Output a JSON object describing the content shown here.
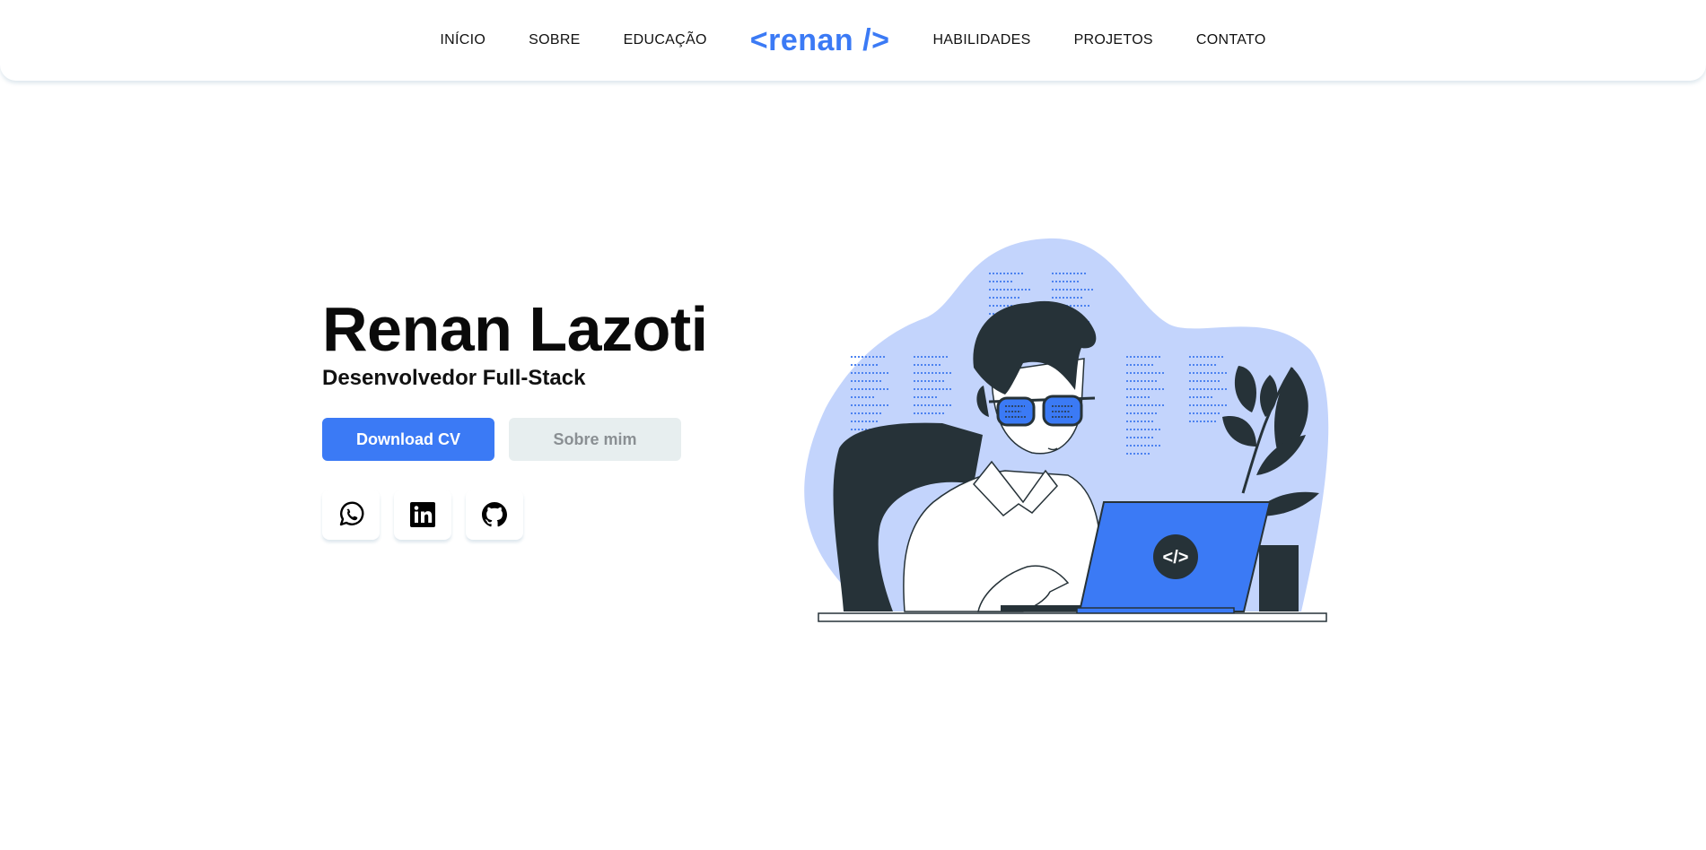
{
  "nav": {
    "links_left": [
      "INÍCIO",
      "SOBRE",
      "EDUCAÇÃO"
    ],
    "logo": "<renan />",
    "links_right": [
      "HABILIDADES",
      "PROJETOS",
      "CONTATO"
    ]
  },
  "hero": {
    "name": "Renan Lazoti",
    "role": "Desenvolvedor Full-Stack",
    "primary_button": "Download CV",
    "secondary_button": "Sobre mim"
  },
  "social": {
    "icons": [
      "whatsapp-icon",
      "linkedin-icon",
      "github-icon"
    ]
  },
  "illustration": {
    "laptop_symbol": "</>"
  },
  "colors": {
    "accent": "#3b7af5",
    "blob": "#c3d4fc",
    "dark": "#263238",
    "secondary_button_bg": "#e7eeef"
  }
}
